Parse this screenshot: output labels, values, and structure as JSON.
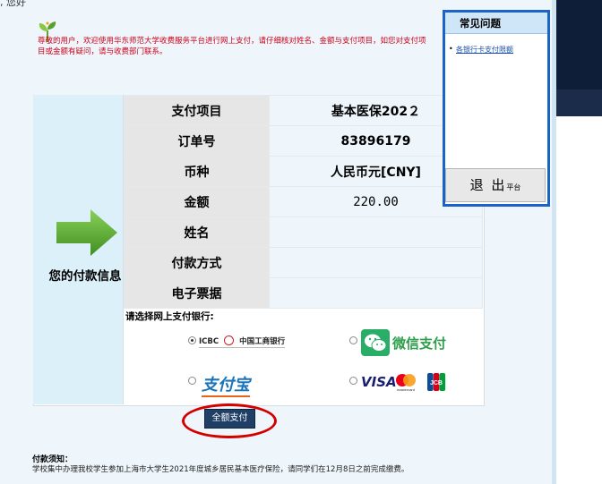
{
  "greeting": ", 您好",
  "notice": "尊敬的用户，欢迎使用华东师范大学收费服务平台进行网上支付，请仔细核对姓名、金额与支付项目，如您对支付项目或金额有疑问，请与收费部门联系。",
  "your_info_label": "您的付款信息",
  "info_rows": [
    {
      "label": "支付项目",
      "value": "基本医保202２"
    },
    {
      "label": "订单号",
      "value": "83896179"
    },
    {
      "label": "币种",
      "value": "人民币元[CNY]"
    },
    {
      "label": "金额",
      "value": "220.00"
    },
    {
      "label": "姓名",
      "value": ""
    },
    {
      "label": "付款方式",
      "value": ""
    },
    {
      "label": "电子票据",
      "value": ""
    }
  ],
  "choose_bank": "请选择网上支付银行:",
  "banks": {
    "icbc_code": "ICBC",
    "icbc_name": "中国工商银行",
    "wechat": "微信支付",
    "alipay": "支付宝",
    "visa": "VISA",
    "mastercard": "mastercard",
    "jcb": "JCB"
  },
  "pay_button": "全额支付",
  "hint_title": "付款须知：",
  "hint_text": "学校集中办理我校学生参加上海市大学生2021年度城乡居民基本医疗保险，请同学们在12月8日之前完成缴费。",
  "faq": {
    "title": "常见问题",
    "link": "各银行卡支付限额"
  },
  "exit_button": {
    "big": "退 出",
    "small": "平台"
  },
  "colors": {
    "accent": "#1a64c8",
    "notice": "#d0021b",
    "arrow": "#5cb532",
    "button": "#1f3f66",
    "highlight": "#d40000"
  }
}
